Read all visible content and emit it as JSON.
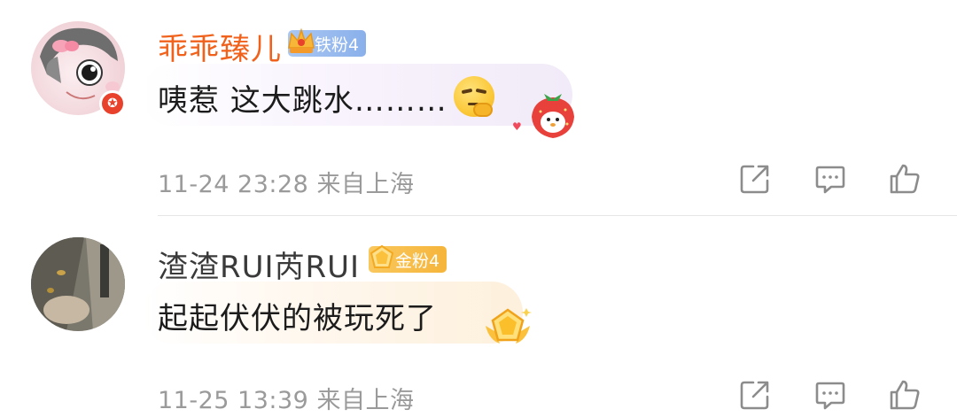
{
  "comments": [
    {
      "username": "乖乖臻儿",
      "fan_badge": "铁粉4",
      "text": "咦惹  这大跳水………",
      "timestamp": "11-24 23:28",
      "location": "来自上海",
      "username_color": "#f0621c",
      "verified_icon": "verified-badge-icon",
      "emoji_icon": "thinking-face-icon",
      "sticker_icon": "strawberry-sticker-icon"
    },
    {
      "username": "渣渣RUI芮RUI",
      "fan_badge": "金粉4",
      "text": "起起伏伏的被玩死了",
      "timestamp": "11-25 13:39",
      "location": "来自上海",
      "username_color": "#3a3a3a",
      "sticker_icon": "gold-medal-sticker-icon"
    }
  ],
  "actions": [
    "repost-icon",
    "reply-icon",
    "like-icon"
  ]
}
